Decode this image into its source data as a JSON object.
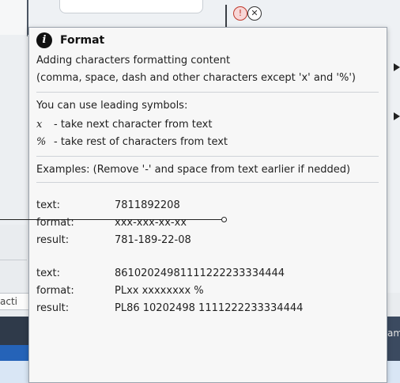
{
  "background": {
    "action_label": "acti",
    "right_label": "am"
  },
  "tooltip": {
    "icon": "info-icon",
    "title": "Format",
    "description_line1": "Adding characters formatting content",
    "description_line2": "(comma, space, dash and other characters except 'x' and '%')",
    "leading_symbols_intro": "You can use leading symbols:",
    "symbols": [
      {
        "symbol": "x",
        "description": "- take next character from text"
      },
      {
        "symbol": "%",
        "description": "- take rest of characters from text"
      }
    ],
    "examples_intro": "Examples: (Remove '-' and space from text earlier if nedded)",
    "examples": [
      {
        "text_label": "text:",
        "text_value": "7811892208",
        "format_label": "format:",
        "format_value": "xxx-xxx-xx-xx",
        "result_label": "result:",
        "result_value": "781-189-22-08"
      },
      {
        "text_label": "text:",
        "text_value": "86102024981111222233334444",
        "format_label": "format:",
        "format_value": "PLxx xxxxxxxx %",
        "result_label": "result:",
        "result_value": "PL86 10202498 1111222233334444"
      }
    ]
  }
}
